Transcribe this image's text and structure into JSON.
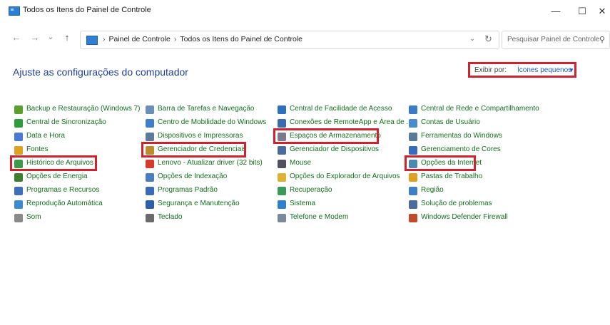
{
  "window": {
    "title": "Todos os Itens do Painel de Controle",
    "minimize": "—",
    "maximize": "☐",
    "close": "✕"
  },
  "nav": {
    "back": "←",
    "forward": "→",
    "recent": "⌄",
    "up": "↑",
    "breadcrumb": [
      "Painel de Controle",
      "Todos os Itens do Painel de Controle"
    ],
    "separator": "›",
    "dropdown": "⌄",
    "refresh": "↻",
    "search_placeholder": "Pesquisar Painel de Controle",
    "search_icon": "⚲"
  },
  "main": {
    "heading": "Ajuste as configurações do computador",
    "view_by_label": "Exibir por:",
    "view_by_value": "Ícones pequenos",
    "view_by_arrow": "▼"
  },
  "items": [
    [
      "Backup e Restauração (Windows 7)",
      "Central de Sincronização",
      "Data e Hora",
      "Fontes",
      "Histórico de Arquivos",
      "Opções de Energia",
      "Programas e Recursos",
      "Reprodução Automática",
      "Som"
    ],
    [
      "Barra de Tarefas e Navegação",
      "Centro de Mobilidade do Windows",
      "Dispositivos e Impressoras",
      "Gerenciador de Credenciais",
      "Lenovo - Atualizar driver (32 bits)",
      "Opções de Indexação",
      "Programas Padrão",
      "Segurança e Manutenção",
      "Teclado"
    ],
    [
      "Central de Facilidade de Acesso",
      "Conexões de RemoteApp e Área de ...",
      "Espaços de Armazenamento",
      "Gerenciador de Dispositivos",
      "Mouse",
      "Opções do Explorador de Arquivos",
      "Recuperação",
      "Sistema",
      "Telefone e Modem"
    ],
    [
      "Central de Rede e Compartilhamento",
      "Contas de Usuário",
      "Ferramentas do Windows",
      "Gerenciamento de Cores",
      "Opções da Internet",
      "Pastas de Trabalho",
      "Região",
      "Solução de problemas",
      "Windows Defender Firewall"
    ]
  ],
  "icon_colors": [
    [
      "#5aa02c",
      "#2d9c3c",
      "#4a7bd0",
      "#e0a020",
      "#3a9a4a",
      "#3c7d2e",
      "#3f6fb8",
      "#3c8ad0",
      "#8a8a8a"
    ],
    [
      "#6b8fb8",
      "#3f7ec8",
      "#5b7a9a",
      "#c08a2a",
      "#d53a2a",
      "#4a7cc0",
      "#3a6ab8",
      "#2d5fa8",
      "#6a6a6a"
    ],
    [
      "#2f6fc0",
      "#3a6ab0",
      "#7a7a8a",
      "#4a6aa0",
      "#505060",
      "#e0b030",
      "#3a9a5a",
      "#2f7fd0",
      "#7a8a9a"
    ],
    [
      "#3a7ac8",
      "#4a8ad0",
      "#5a7a9a",
      "#3a6ac0",
      "#4a8ab0",
      "#e0a020",
      "#3f7ec8",
      "#4a6aa0",
      "#c04a2a"
    ]
  ],
  "highlighted": [
    "Histórico de Arquivos",
    "Gerenciador de Credenciais",
    "Espaços de Armazenamento",
    "Opções da Internet",
    "Exibir por"
  ]
}
